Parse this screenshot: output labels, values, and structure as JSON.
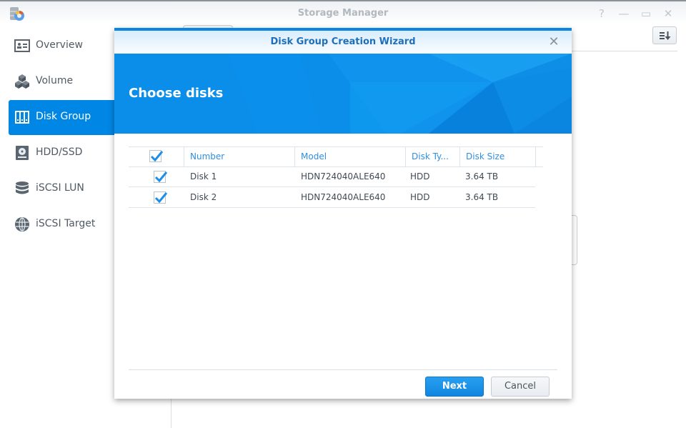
{
  "app": {
    "title": "Storage Manager",
    "window_controls": [
      "help-icon",
      "minimize-icon",
      "maximize-icon",
      "close-icon"
    ],
    "help_glyph": "?",
    "minimize_glyph": "—",
    "maximize_glyph": "▭",
    "close_glyph": "✕"
  },
  "sidebar": {
    "items": [
      {
        "label": "Overview",
        "icon": "overview-icon",
        "active": false
      },
      {
        "label": "Volume",
        "icon": "cubes-icon",
        "active": false
      },
      {
        "label": "Disk Group",
        "icon": "disk-group-icon",
        "active": true
      },
      {
        "label": "HDD/SSD",
        "icon": "hdd-icon",
        "active": false
      },
      {
        "label": "iSCSI LUN",
        "icon": "database-icon",
        "active": false
      },
      {
        "label": "iSCSI Target",
        "icon": "globe-icon",
        "active": false
      }
    ]
  },
  "dialog": {
    "title": "Disk Group Creation Wizard",
    "close_glyph": "✕",
    "step_title": "Choose disks",
    "table": {
      "select_all_checked": true,
      "columns": [
        "Number",
        "Model",
        "Disk Ty...",
        "Disk Size"
      ],
      "rows": [
        {
          "checked": true,
          "number": "Disk 1",
          "model": "HDN724040ALE640",
          "type": "HDD",
          "size": "3.64 TB"
        },
        {
          "checked": true,
          "number": "Disk 2",
          "model": "HDN724040ALE640",
          "type": "HDD",
          "size": "3.64 TB"
        }
      ]
    },
    "buttons": {
      "next": "Next",
      "cancel": "Cancel"
    }
  },
  "colors": {
    "accent": "#0086e5",
    "header_text": "#2f8fe0",
    "check": "#1a8ee8"
  }
}
